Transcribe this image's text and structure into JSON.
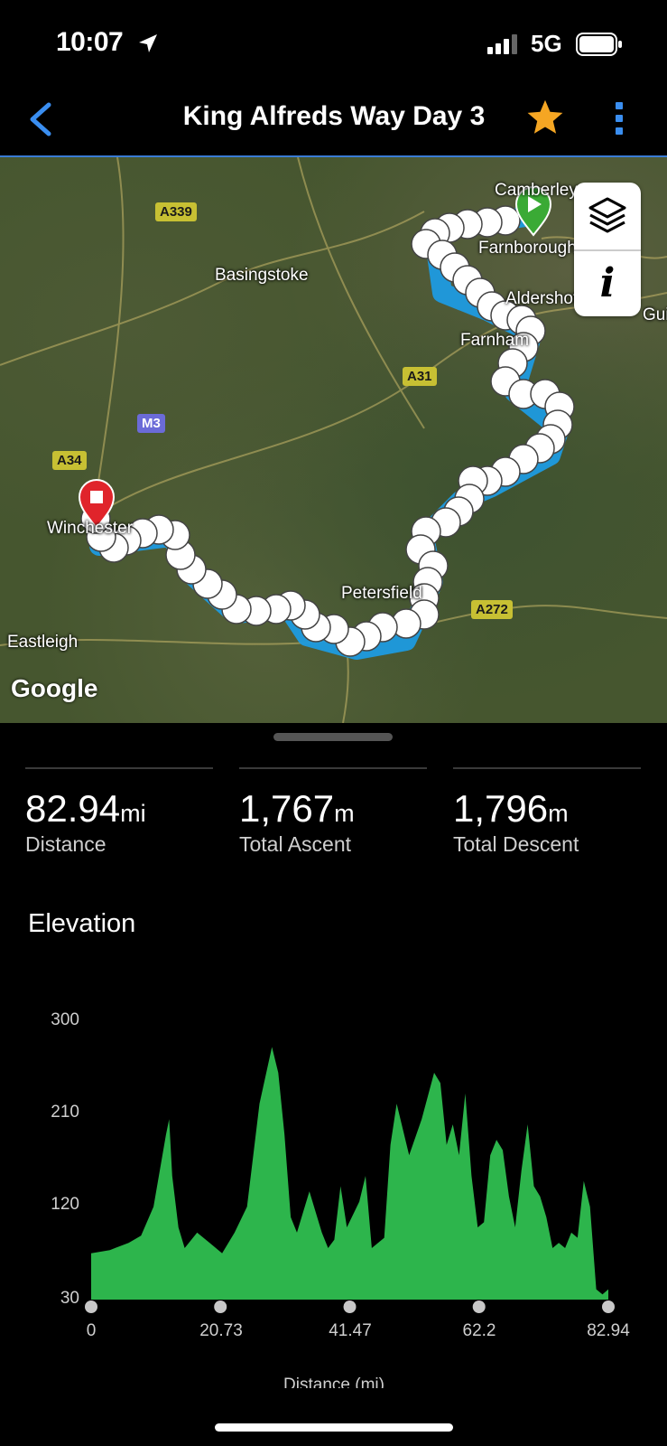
{
  "status_bar": {
    "time": "10:07",
    "network": "5G"
  },
  "nav": {
    "title": "King Alfreds Way Day 3"
  },
  "map": {
    "places": [
      "Camberley",
      "Farnborough",
      "Basingstoke",
      "Aldershot",
      "Farnham",
      "Winchester",
      "Petersfield",
      "Eastleigh",
      "Guildford"
    ],
    "roads": [
      "A339",
      "A31",
      "M3",
      "A34",
      "A272"
    ],
    "attribution": "Google",
    "info_label": "i"
  },
  "stats": {
    "distance": {
      "value": "82.94",
      "unit": "mi",
      "label": "Distance"
    },
    "ascent": {
      "value": "1,767",
      "unit": "m",
      "label": "Total Ascent"
    },
    "descent": {
      "value": "1,796",
      "unit": "m",
      "label": "Total Descent"
    }
  },
  "elevation": {
    "title": "Elevation",
    "y_ticks": [
      "300",
      "210",
      "120",
      "30"
    ],
    "x_ticks": [
      "0",
      "20.73",
      "41.47",
      "62.2",
      "82.94"
    ],
    "x_title": "Distance (mi)"
  },
  "chart_data": {
    "type": "area",
    "xlabel": "Distance (mi)",
    "ylabel": "",
    "xlim": [
      0,
      82.94
    ],
    "ylim": [
      30,
      300
    ],
    "color": "#2db54c",
    "x": [
      0,
      3,
      6,
      8,
      10,
      12,
      12.5,
      13,
      14,
      15,
      17,
      19,
      21,
      23,
      25,
      27,
      29,
      30,
      31,
      32,
      33,
      35,
      37,
      38,
      39,
      40,
      41,
      43,
      44,
      45,
      47,
      48,
      49,
      51,
      53,
      55,
      56,
      57,
      58,
      59,
      60,
      61,
      62,
      63,
      64,
      65,
      66,
      67,
      68,
      69,
      70,
      71,
      72,
      73,
      74,
      75,
      76,
      77,
      78,
      79,
      80,
      81,
      82,
      82.94
    ],
    "y": [
      75,
      78,
      85,
      92,
      120,
      190,
      205,
      150,
      100,
      80,
      95,
      85,
      75,
      95,
      120,
      220,
      275,
      250,
      190,
      110,
      95,
      135,
      95,
      80,
      88,
      140,
      100,
      125,
      150,
      80,
      90,
      180,
      220,
      170,
      205,
      250,
      240,
      180,
      200,
      170,
      230,
      150,
      100,
      105,
      170,
      185,
      175,
      130,
      100,
      155,
      200,
      140,
      130,
      110,
      80,
      85,
      80,
      95,
      90,
      145,
      120,
      40,
      35,
      40
    ]
  },
  "colors": {
    "accent": "#3a8ef0",
    "star": "#f5a623",
    "route": "#1e9be0",
    "start": "#3aaa35",
    "end": "#e0242b",
    "elevation_fill": "#2db54c"
  }
}
